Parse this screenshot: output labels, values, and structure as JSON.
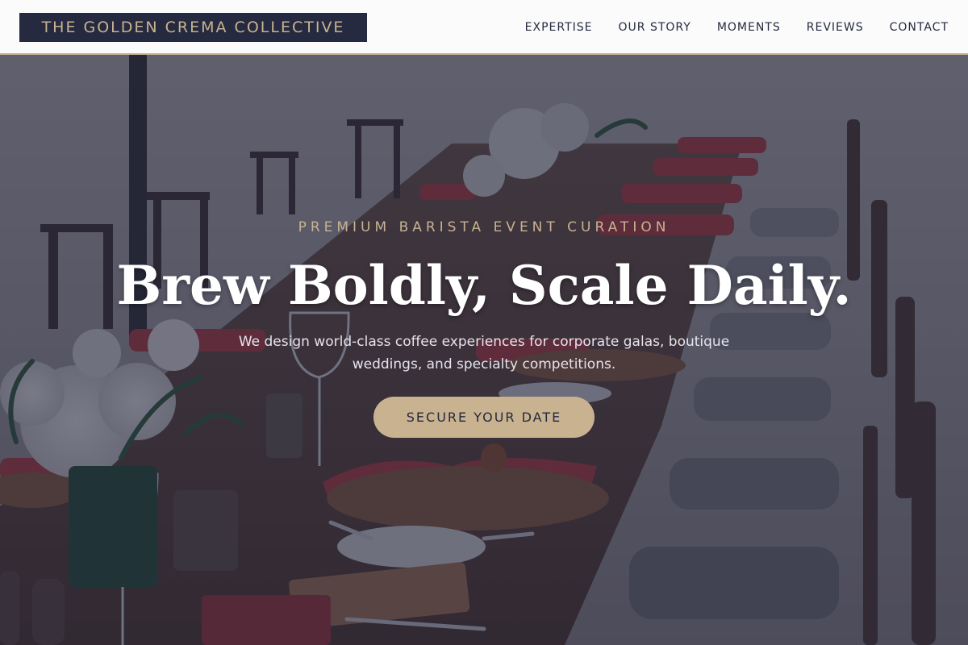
{
  "brand": {
    "name": "THE GOLDEN CREMA COLLECTIVE"
  },
  "nav": {
    "items": [
      {
        "label": "EXPERTISE"
      },
      {
        "label": "OUR STORY"
      },
      {
        "label": "MOMENTS"
      },
      {
        "label": "REVIEWS"
      },
      {
        "label": "CONTACT"
      }
    ]
  },
  "hero": {
    "eyebrow": "PREMIUM BARISTA EVENT CURATION",
    "headline": "Brew Boldly, Scale Daily.",
    "subtext": "We design world-class coffee experiences for corporate galas, boutique weddings, and specialty competitions.",
    "cta_label": "SECURE YOUR DATE",
    "background_image": "banquet-table-photo"
  },
  "colors": {
    "navy": "#252a40",
    "gold": "#c8b290",
    "white": "#ffffff"
  }
}
